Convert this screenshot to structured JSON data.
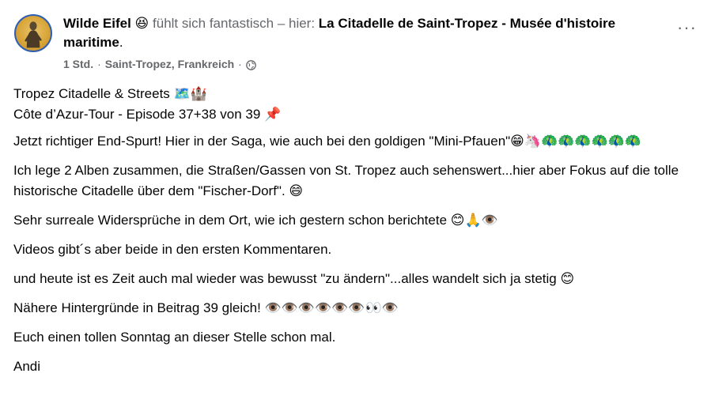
{
  "header": {
    "author": "Wilde Eifel",
    "feeling_emoji": "😆",
    "feeling_text": " fühlt sich fantastisch – hier: ",
    "place": "La Citadelle de Saint-Tropez - Musée d'histoire maritime",
    "place_suffix": ".",
    "time": "1 Std.",
    "location": "Saint-Tropez, Frankreich",
    "separator": "·",
    "privacy_icon": "globe-icon",
    "more": "···"
  },
  "post": {
    "title_line1": "Tropez Citadelle & Streets 🗺️🏰",
    "title_line2": "Côte d’Azur-Tour - Episode 37+38 von 39 📌",
    "p1": "Jetzt richtiger End-Spurt! Hier in der Saga, wie auch bei den goldigen \"Mini-Pfauen\"😁🦄🦚🦚🦚🦚🦚🦚",
    "p2": "Ich lege 2 Alben zusammen, die Straßen/Gassen von St. Tropez auch sehenswert...hier aber Fokus auf die tolle historische Citadelle über dem \"Fischer-Dorf\". 😄",
    "p3": "Sehr surreale Widersprüche in dem Ort, wie ich gestern schon berichtete 😊🙏👁️",
    "p4": "Videos gibt´s aber beide in den ersten Kommentaren.",
    "p5": "und heute ist es Zeit auch mal wieder was bewusst \"zu ändern\"...alles wandelt sich ja stetig 😊",
    "p6": "Nähere Hintergründe in Beitrag 39 gleich! 👁️👁️👁️👁️👁️👁️👀👁️",
    "p7": "Euch einen tollen Sonntag an dieser Stelle schon mal.",
    "p8": "Andi"
  }
}
